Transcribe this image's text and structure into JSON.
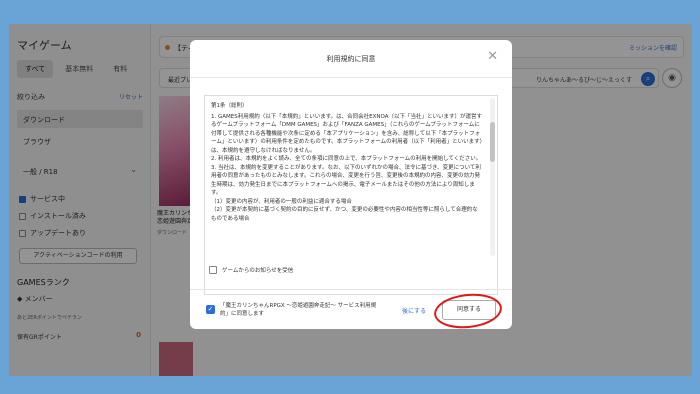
{
  "sidebar": {
    "title": "マイゲーム",
    "tabs": [
      "すべて",
      "基本無料",
      "有料"
    ],
    "filter_label": "絞り込み",
    "reset_label": "リセット",
    "items": [
      "ダウンロード",
      "ブラウザ"
    ],
    "rating": "一般 / R18",
    "checks": [
      {
        "label": "サービス中",
        "checked": true
      },
      {
        "label": "インストール済み",
        "checked": false
      },
      {
        "label": "アップデートあり",
        "checked": false
      }
    ],
    "activation_button": "アクティベーションコードの利用",
    "rank_title": "GAMESランク",
    "member": "メンバー",
    "next_rank": "あと2ERポイントでベテラン",
    "points_label": "保有GRポイント",
    "points_value": "0"
  },
  "main": {
    "top_bar": "【ティ",
    "mission_link": "ミッションを確認",
    "search_prefix": "最近プレ",
    "search_query": "りんちゃんあ〜るぴ〜じ〜えっくす",
    "search_icon": "search-icon",
    "eye_icon": "eye-icon",
    "game_title": "魔王カリンち\n恋姫遊園奔走",
    "game_download": "ダウンロード"
  },
  "modal": {
    "title": "利用規約に同意",
    "close_icon": "close-icon",
    "terms": [
      "第1条（総則）",
      "1. GAMES利用規約（以下「本規約」といいます。は、合同会社EXNOA（以下「当社」といいます）が運営するゲームプラットフォーム「DMM GAMES」および「FANZA GAMES」（これらのゲームプラットフォームに付帯して提供される各種機能や次条に定める「本アプリケーション」を含み、総称して以下「本プラットフォーム」といいます）の利用条件を定めたものです。本プラットフォームの利用者（以下「利用者」といいます）は、本規約を遵守しなければなりません。",
      "2. 利用者は、本規約をよく読み、全ての条項に同意の上で、本プラットフォームの利用を開始してください。",
      "3. 当社は、本規約を変更することがあります。なお、以下のいずれかの場合、法令に基づき、変更について利用者の同意があったものとみなします。これらの場合、変更を行う旨、変更後の本規約の内容、変更の効力発生時期は、効力発生日までに本プラットフォームへの掲示、電子メールまたはその他の方法により周知します。",
      "（1）変更の内容が、利用者の一般の利益に適合する場合",
      "（2）変更が本契約に基づく契約の目的に反せず、かつ、変更の必要性や内容の相当性等に照らして合理的なものである場合"
    ],
    "notify_label": "ゲームからのお知らせを受信",
    "agree_text": "「魔王カリンちゃんRPGX 〜恋姫遊園奔走記〜 サービス利用規約」に同意します",
    "later_button": "後にする",
    "agree_button": "同意する"
  }
}
